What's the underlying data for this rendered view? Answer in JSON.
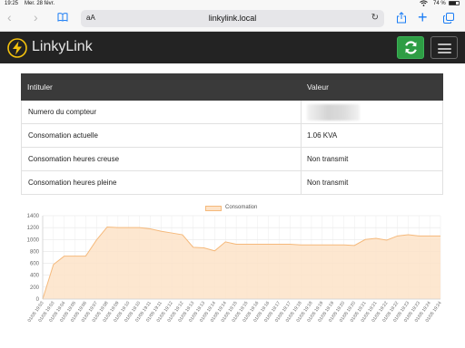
{
  "status_bar": {
    "time": "19:25",
    "date": "Mer. 28 févr.",
    "battery": "74 %",
    "battery_level": 0.74
  },
  "browser": {
    "text_size_label": "aA",
    "url": "linkylink.local",
    "back_icon": "chevron-left-icon",
    "forward_icon": "chevron-right-icon",
    "bookmarks_icon": "book-icon",
    "reload_icon": "reload-icon",
    "share_icon": "share-icon",
    "new_tab_icon": "plus-icon",
    "tabs_icon": "tabs-icon",
    "accent_color": "#1a7cf5"
  },
  "navbar": {
    "brand": "LinkyLink",
    "logo_icon": "lightning-bolt-icon",
    "refresh_icon": "refresh-icon",
    "menu_icon": "hamburger-menu-icon",
    "refresh_color": "#2e9d44",
    "logo_color": "#f4c20d"
  },
  "table": {
    "headers": [
      "Intituler",
      "Valeur"
    ],
    "rows": [
      {
        "label": "Numero du compteur",
        "value": ""
      },
      {
        "label": "Consomation actuelle",
        "value": "1.06 KVA"
      },
      {
        "label": "Consomation heures creuse",
        "value": "Non transmit"
      },
      {
        "label": "Consomation heures pleine",
        "value": "Non transmit"
      }
    ]
  },
  "chart_data": {
    "type": "area",
    "title": "",
    "xlabel": "",
    "ylabel": "",
    "ylim": [
      0,
      1400
    ],
    "y_ticks": [
      0,
      200,
      400,
      600,
      800,
      1000,
      1200,
      1400
    ],
    "x": [
      "01/05 19:03",
      "01/05 19:03",
      "01/05 19:04",
      "01/05 19:05",
      "01/05 19:06",
      "01/05 19:07",
      "01/05 19:08",
      "01/05 19:09",
      "01/05 19:10",
      "01/05 19:10",
      "01/05 19:11",
      "01/05 19:11",
      "01/05 19:12",
      "01/05 19:12",
      "01/05 19:13",
      "01/05 19:13",
      "01/05 19:14",
      "01/05 19:14",
      "01/05 19:15",
      "01/05 19:15",
      "01/05 19:16",
      "01/05 19:16",
      "01/05 19:17",
      "01/05 19:17",
      "01/05 19:18",
      "01/05 19:18",
      "01/05 19:19",
      "01/05 19:19",
      "01/05 19:20",
      "01/05 19:20",
      "01/05 19:21",
      "01/05 19:21",
      "01/05 19:22",
      "01/05 19:22",
      "01/05 19:23",
      "01/05 19:23",
      "01/05 19:24",
      "01/05 19:24"
    ],
    "series": [
      {
        "name": "Consomation",
        "values": [
          0,
          580,
          720,
          720,
          720,
          990,
          1210,
          1200,
          1200,
          1200,
          1180,
          1140,
          1110,
          1080,
          870,
          860,
          810,
          960,
          920,
          920,
          920,
          920,
          920,
          920,
          910,
          910,
          910,
          910,
          910,
          900,
          1000,
          1020,
          990,
          1060,
          1080,
          1060,
          1060,
          1060
        ],
        "fill": "#fde3c8",
        "stroke": "#f5b97b"
      }
    ],
    "grid": true,
    "legend": "top-center"
  }
}
